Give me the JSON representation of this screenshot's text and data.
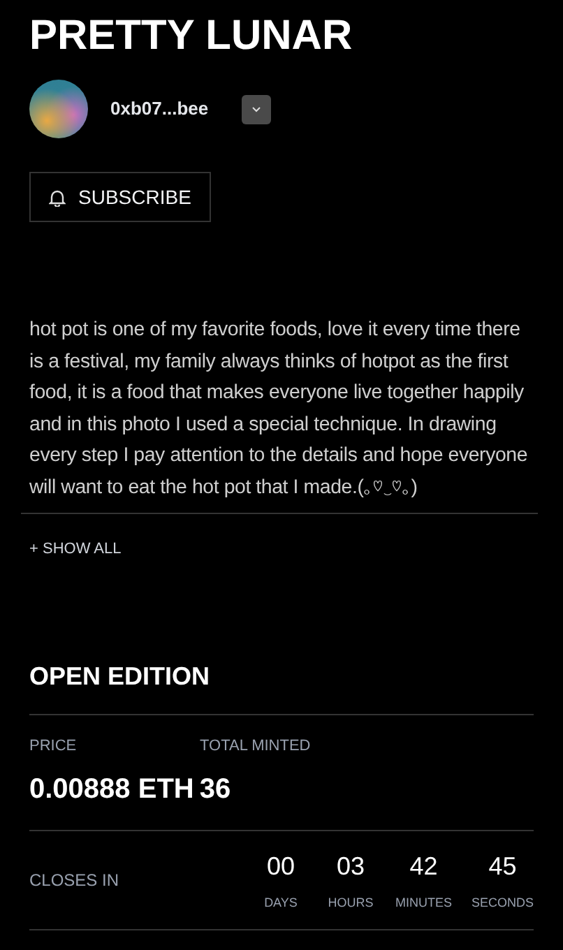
{
  "title": "PRETTY LUNAR",
  "creator": {
    "address": "0xb07...bee"
  },
  "subscribe_button": {
    "label": "SUBSCRIBE"
  },
  "description": "hot pot is one of my favorite foods, love it every time there is a festival, my family always thinks of hotpot as the first food, it is a food that makes everyone live together happily and in this photo I used a special technique. In drawing every step I pay attention to the details and hope everyone will want to eat the hot pot that I made.(｡♡‿♡｡)",
  "show_all": "+ SHOW ALL",
  "edition": {
    "heading": "OPEN EDITION",
    "price_label": "PRICE",
    "price": "0.00888 ETH",
    "minted_label": "TOTAL MINTED",
    "minted": "36"
  },
  "countdown": {
    "label": "CLOSES IN",
    "units": [
      {
        "value": "00",
        "label": "DAYS"
      },
      {
        "value": "03",
        "label": "HOURS"
      },
      {
        "value": "42",
        "label": "MINUTES"
      },
      {
        "value": "45",
        "label": "SECONDS"
      }
    ]
  }
}
